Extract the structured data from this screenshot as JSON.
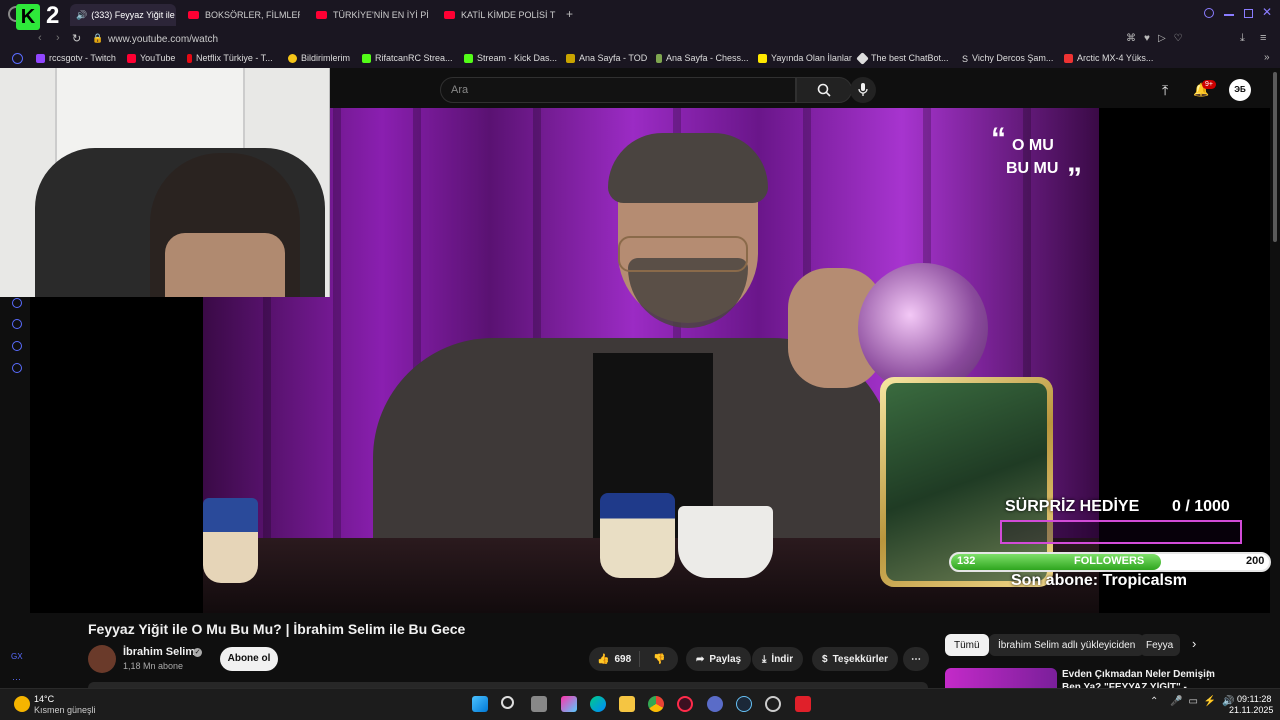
{
  "browser": {
    "tabs": [
      {
        "label": "(333) Feyyaz Yiğit ile O",
        "active": true
      },
      {
        "label": "BOKSÖRLER, FİLMLERDE"
      },
      {
        "label": "TÜRKİYE'NİN EN İYİ PİZZ"
      },
      {
        "label": "KATİL KİMDE POLİSİ TROL"
      }
    ],
    "url": "www.youtube.com/watch",
    "bookmarks": [
      "rccsgotv - Twitch",
      "YouTube",
      "Netflix Türkiye - T...",
      "Bildirimlerim",
      "RifatcanRC Strea...",
      "Stream - Kick Das...",
      "Ana Sayfa - TOD",
      "Ana Sayfa - Chess...",
      "Yayında Olan İlanlar",
      "The best ChatBot...",
      "Vichy Dercos Şam...",
      "Arctic MX-4 Yüks..."
    ]
  },
  "overlay_logo": "2",
  "youtube": {
    "search_placeholder": "Ara",
    "notification_count": "9+",
    "avatar_text": "ЭБ"
  },
  "video_overlay": {
    "quote_line1": "O MU",
    "quote_line2": "BU MU",
    "surprise_label": "SÜRPRİZ HEDİYE",
    "surprise_count": "0  / 1000",
    "surprise_progress": 0,
    "followers_label": "FOLLOWERS",
    "followers_current": "132",
    "followers_goal": "200",
    "followers_progress": 0.66,
    "last_sub": "Son abone: Tropicalsm"
  },
  "video": {
    "title": "Feyyaz Yiğit ile O Mu Bu Mu? | İbrahim Selim ile Bu Gece",
    "channel": "İbrahim Selim",
    "subscribers": "1,18 Mn abone",
    "subscribe_label": "Abone ol",
    "likes": "698",
    "share_label": "Paylaş",
    "download_label": "İndir",
    "thanks_label": "Teşekkürler"
  },
  "chips": [
    "Tümü",
    "İbrahim Selim adlı yükleyiciden",
    "Feyya"
  ],
  "recommendation": {
    "title_line1": "Evden Çıkmadan Neler Demişim",
    "title_line2": "Ben Ya? \"FEYYAZ YİĞİT\" -"
  },
  "sidebar_gx": "GX",
  "taskbar": {
    "weather_temp": "14°C",
    "weather_desc": "Kısmen güneşli",
    "time": "09:11:28",
    "date": "21.11.2025"
  }
}
